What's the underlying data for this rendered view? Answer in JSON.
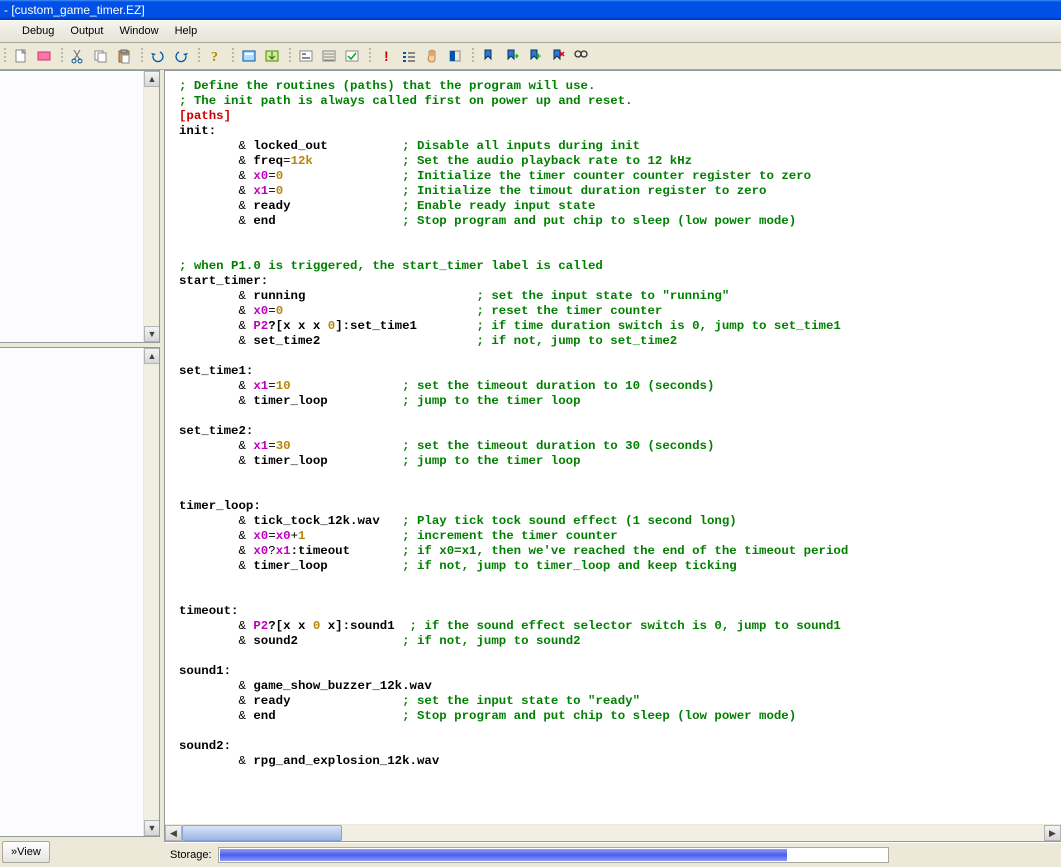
{
  "title": "- [custom_game_timer.EZ]",
  "menu": {
    "items": [
      "Debug",
      "Output",
      "Window",
      "Help"
    ]
  },
  "toolbar_icons": [
    [
      "new",
      "open",
      "save"
    ],
    [
      "cut",
      "copy",
      "paste"
    ],
    [
      "undo",
      "redo"
    ],
    [
      "help"
    ],
    [
      "box1",
      "box2"
    ],
    [
      "box3",
      "box4",
      "box5"
    ],
    [
      "red-excl",
      "list",
      "hand",
      "toggle"
    ],
    [
      "blue-flag",
      "flag-next",
      "flag-prev",
      "flag-clear",
      "binoculars"
    ]
  ],
  "view_button": "»View",
  "code": [
    {
      "t": "comment",
      "text": "; Define the routines (paths) that the program will use."
    },
    {
      "t": "comment",
      "text": "; The init path is always called first on power up and reset."
    },
    {
      "t": "paths",
      "text": "[paths]"
    },
    {
      "t": "label",
      "text": "init:"
    },
    {
      "t": "cmd",
      "indent": 2,
      "parts": [
        {
          "p": "& ",
          "c": "amp"
        },
        {
          "p": "locked_out",
          "c": "cmd"
        }
      ],
      "comment": "; Disable all inputs during init",
      "ccol": 30
    },
    {
      "t": "cmd",
      "indent": 2,
      "parts": [
        {
          "p": "& ",
          "c": "amp"
        },
        {
          "p": "freq",
          "c": "cmd"
        },
        {
          "p": "=",
          "c": "amp"
        },
        {
          "p": "12k",
          "c": "num"
        }
      ],
      "comment": "; Set the audio playback rate to 12 kHz",
      "ccol": 30
    },
    {
      "t": "cmd",
      "indent": 2,
      "parts": [
        {
          "p": "& ",
          "c": "amp"
        },
        {
          "p": "x0",
          "c": "var"
        },
        {
          "p": "=",
          "c": "amp"
        },
        {
          "p": "0",
          "c": "num"
        }
      ],
      "comment": "; Initialize the timer counter counter register to zero",
      "ccol": 30
    },
    {
      "t": "cmd",
      "indent": 2,
      "parts": [
        {
          "p": "& ",
          "c": "amp"
        },
        {
          "p": "x1",
          "c": "var"
        },
        {
          "p": "=",
          "c": "amp"
        },
        {
          "p": "0",
          "c": "num"
        }
      ],
      "comment": "; Initialize the timout duration register to zero",
      "ccol": 30
    },
    {
      "t": "cmd",
      "indent": 2,
      "parts": [
        {
          "p": "& ",
          "c": "amp"
        },
        {
          "p": "ready",
          "c": "cmd"
        }
      ],
      "comment": "; Enable ready input state",
      "ccol": 30
    },
    {
      "t": "cmd",
      "indent": 2,
      "parts": [
        {
          "p": "& ",
          "c": "amp"
        },
        {
          "p": "end",
          "c": "cmd"
        }
      ],
      "comment": "; Stop program and put chip to sleep (low power mode)",
      "ccol": 30
    },
    {
      "t": "blank"
    },
    {
      "t": "blank"
    },
    {
      "t": "comment",
      "text": "; when P1.0 is triggered, the start_timer label is called"
    },
    {
      "t": "label",
      "text": "start_timer:"
    },
    {
      "t": "cmd",
      "indent": 2,
      "parts": [
        {
          "p": "& ",
          "c": "amp"
        },
        {
          "p": "running",
          "c": "cmd"
        }
      ],
      "comment": "; set the input state to \"running\"",
      "ccol": 40
    },
    {
      "t": "cmd",
      "indent": 2,
      "parts": [
        {
          "p": "& ",
          "c": "amp"
        },
        {
          "p": "x0",
          "c": "var"
        },
        {
          "p": "=",
          "c": "amp"
        },
        {
          "p": "0",
          "c": "num"
        }
      ],
      "comment": "; reset the timer counter",
      "ccol": 40
    },
    {
      "t": "cmd",
      "indent": 2,
      "parts": [
        {
          "p": "& ",
          "c": "amp"
        },
        {
          "p": "P2",
          "c": "var"
        },
        {
          "p": "?[x x x ",
          "c": "cmd"
        },
        {
          "p": "0",
          "c": "num"
        },
        {
          "p": "]:set_time1",
          "c": "cmd"
        }
      ],
      "comment": "; if time duration switch is 0, jump to set_time1",
      "ccol": 40
    },
    {
      "t": "cmd",
      "indent": 2,
      "parts": [
        {
          "p": "& ",
          "c": "amp"
        },
        {
          "p": "set_time2",
          "c": "cmd"
        }
      ],
      "comment": "; if not, jump to set_time2",
      "ccol": 40
    },
    {
      "t": "blank"
    },
    {
      "t": "label",
      "text": "set_time1:"
    },
    {
      "t": "cmd",
      "indent": 2,
      "parts": [
        {
          "p": "& ",
          "c": "amp"
        },
        {
          "p": "x1",
          "c": "var"
        },
        {
          "p": "=",
          "c": "amp"
        },
        {
          "p": "10",
          "c": "num"
        }
      ],
      "comment": "; set the timeout duration to 10 (seconds)",
      "ccol": 30
    },
    {
      "t": "cmd",
      "indent": 2,
      "parts": [
        {
          "p": "& ",
          "c": "amp"
        },
        {
          "p": "timer_loop",
          "c": "cmd"
        }
      ],
      "comment": "; jump to the timer loop",
      "ccol": 30
    },
    {
      "t": "blank"
    },
    {
      "t": "label",
      "text": "set_time2:"
    },
    {
      "t": "cmd",
      "indent": 2,
      "parts": [
        {
          "p": "& ",
          "c": "amp"
        },
        {
          "p": "x1",
          "c": "var"
        },
        {
          "p": "=",
          "c": "amp"
        },
        {
          "p": "30",
          "c": "num"
        }
      ],
      "comment": "; set the timeout duration to 30 (seconds)",
      "ccol": 30
    },
    {
      "t": "cmd",
      "indent": 2,
      "parts": [
        {
          "p": "& ",
          "c": "amp"
        },
        {
          "p": "timer_loop",
          "c": "cmd"
        }
      ],
      "comment": "; jump to the timer loop",
      "ccol": 30
    },
    {
      "t": "blank"
    },
    {
      "t": "blank"
    },
    {
      "t": "label",
      "text": "timer_loop:"
    },
    {
      "t": "cmd",
      "indent": 2,
      "parts": [
        {
          "p": "& ",
          "c": "amp"
        },
        {
          "p": "tick_tock_12k.wav",
          "c": "cmd"
        }
      ],
      "comment": "; Play tick tock sound effect (1 second long)",
      "ccol": 30
    },
    {
      "t": "cmd",
      "indent": 2,
      "parts": [
        {
          "p": "& ",
          "c": "amp"
        },
        {
          "p": "x0",
          "c": "var"
        },
        {
          "p": "=",
          "c": "amp"
        },
        {
          "p": "x0",
          "c": "var"
        },
        {
          "p": "+",
          "c": "amp"
        },
        {
          "p": "1",
          "c": "num"
        }
      ],
      "comment": "; increment the timer counter",
      "ccol": 30
    },
    {
      "t": "cmd",
      "indent": 2,
      "parts": [
        {
          "p": "& ",
          "c": "amp"
        },
        {
          "p": "x0",
          "c": "var"
        },
        {
          "p": "?",
          "c": "amp"
        },
        {
          "p": "x1",
          "c": "var"
        },
        {
          "p": ":timeout",
          "c": "cmd"
        }
      ],
      "comment": "; if x0=x1, then we've reached the end of the timeout period",
      "ccol": 30
    },
    {
      "t": "cmd",
      "indent": 2,
      "parts": [
        {
          "p": "& ",
          "c": "amp"
        },
        {
          "p": "timer_loop",
          "c": "cmd"
        }
      ],
      "comment": "; if not, jump to timer_loop and keep ticking",
      "ccol": 30
    },
    {
      "t": "blank"
    },
    {
      "t": "blank"
    },
    {
      "t": "label",
      "text": "timeout:"
    },
    {
      "t": "cmd",
      "indent": 2,
      "parts": [
        {
          "p": "& ",
          "c": "amp"
        },
        {
          "p": "P2",
          "c": "var"
        },
        {
          "p": "?[x x ",
          "c": "cmd"
        },
        {
          "p": "0",
          "c": "num"
        },
        {
          "p": " x]:sound1",
          "c": "cmd"
        }
      ],
      "comment": "; if the sound effect selector switch is 0, jump to sound1",
      "ccol": 30
    },
    {
      "t": "cmd",
      "indent": 2,
      "parts": [
        {
          "p": "& ",
          "c": "amp"
        },
        {
          "p": "sound2",
          "c": "cmd"
        }
      ],
      "comment": "; if not, jump to sound2",
      "ccol": 30
    },
    {
      "t": "blank"
    },
    {
      "t": "label",
      "text": "sound1:"
    },
    {
      "t": "cmd",
      "indent": 2,
      "parts": [
        {
          "p": "& ",
          "c": "amp"
        },
        {
          "p": "game_show_buzzer_12k.wav",
          "c": "cmd"
        }
      ]
    },
    {
      "t": "cmd",
      "indent": 2,
      "parts": [
        {
          "p": "& ",
          "c": "amp"
        },
        {
          "p": "ready",
          "c": "cmd"
        }
      ],
      "comment": "; set the input state to \"ready\"",
      "ccol": 30
    },
    {
      "t": "cmd",
      "indent": 2,
      "parts": [
        {
          "p": "& ",
          "c": "amp"
        },
        {
          "p": "end",
          "c": "cmd"
        }
      ],
      "comment": "; Stop program and put chip to sleep (low power mode)",
      "ccol": 30
    },
    {
      "t": "blank"
    },
    {
      "t": "label",
      "text": "sound2:"
    },
    {
      "t": "cmd",
      "indent": 2,
      "parts": [
        {
          "p": "& ",
          "c": "amp"
        },
        {
          "p": "rpg_and_explosion_12k.wav",
          "c": "cmd"
        }
      ]
    }
  ],
  "status": {
    "label": "Storage:",
    "progress_pct": 85
  },
  "colors": {
    "comment": "#008000",
    "keyword": "#cc0000",
    "variable": "#c000c0",
    "number": "#b8860b"
  }
}
